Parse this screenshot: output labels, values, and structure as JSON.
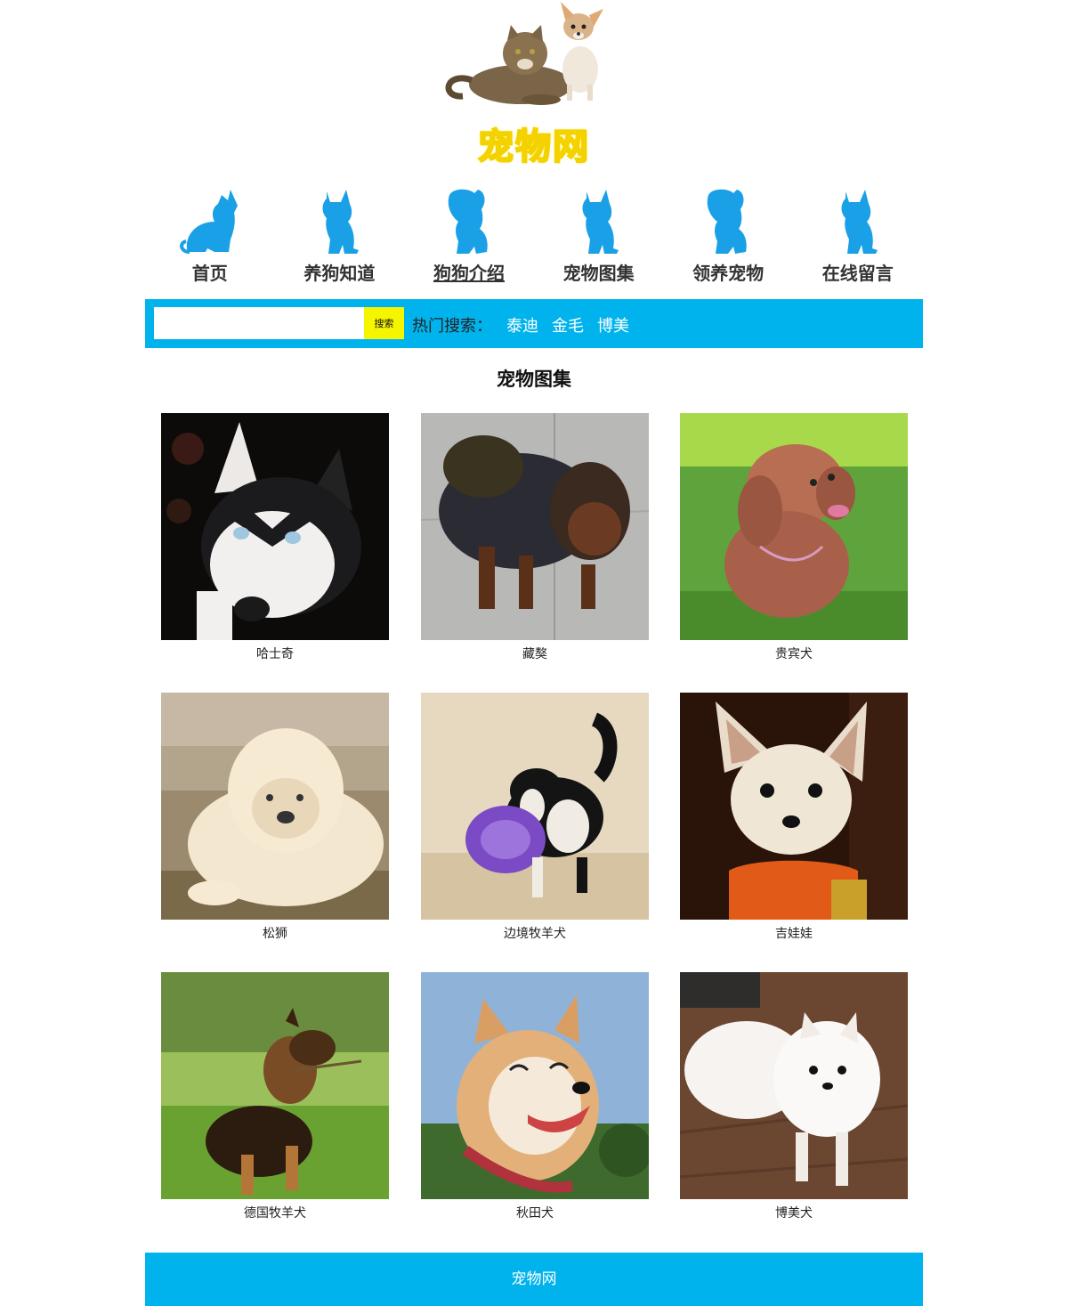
{
  "site": {
    "logo_text": "宠物网"
  },
  "nav": {
    "items": [
      {
        "label": "首页",
        "icon": "cat-silhouette-icon"
      },
      {
        "label": "养狗知道",
        "icon": "kitten-silhouette-icon"
      },
      {
        "label": "狗狗介绍",
        "icon": "puppy-silhouette-icon",
        "active": true
      },
      {
        "label": "宠物图集",
        "icon": "kitten-silhouette-icon"
      },
      {
        "label": "领养宠物",
        "icon": "puppy-silhouette-icon"
      },
      {
        "label": "在线留言",
        "icon": "cat-silhouette-icon"
      }
    ],
    "icon_color": "#1aa0e6"
  },
  "search": {
    "value": "",
    "button_label": "搜索",
    "hot_label": "热门搜索：",
    "hot_links": [
      "泰迪",
      "金毛",
      "博美"
    ],
    "bar_color": "#00b3ec",
    "button_color": "#f5f500"
  },
  "gallery": {
    "title": "宠物图集",
    "items": [
      {
        "caption": "哈士奇",
        "image": "husky-photo"
      },
      {
        "caption": "藏獒",
        "image": "tibetan-mastiff-photo"
      },
      {
        "caption": "贵宾犬",
        "image": "poodle-photo"
      },
      {
        "caption": "松狮",
        "image": "chow-chow-photo"
      },
      {
        "caption": "边境牧羊犬",
        "image": "border-collie-photo"
      },
      {
        "caption": "吉娃娃",
        "image": "chihuahua-photo"
      },
      {
        "caption": "德国牧羊犬",
        "image": "german-shepherd-photo"
      },
      {
        "caption": "秋田犬",
        "image": "akita-photo"
      },
      {
        "caption": "博美犬",
        "image": "pomeranian-photo"
      }
    ]
  },
  "footer": {
    "text": "宠物网"
  }
}
